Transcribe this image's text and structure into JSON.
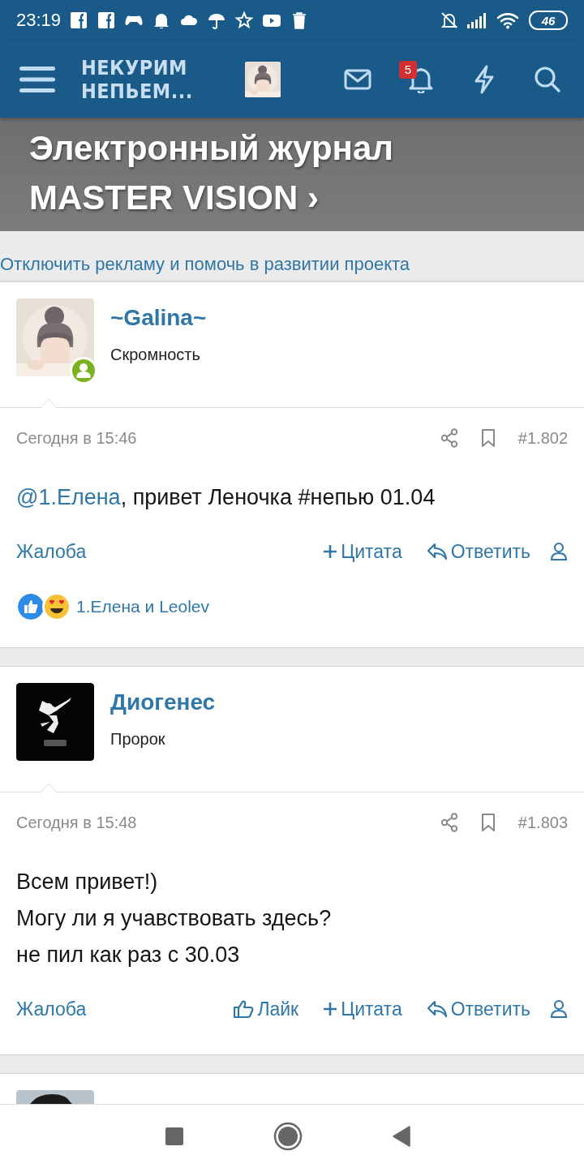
{
  "status_bar": {
    "time": "23:19",
    "battery": "46"
  },
  "header": {
    "logo": [
      "НЕКУРИМ",
      "НЕПЬЕМ..."
    ],
    "notification_count": "5"
  },
  "banner": {
    "lines": [
      "Электронный журнал",
      "MASTER VISION ›"
    ]
  },
  "ad_link": "Отключить рекламу и помочь в развитии проекта",
  "posts": [
    {
      "author": "~Galina~",
      "user_title": "Скромность",
      "online": true,
      "date": "Сегодня в 15:46",
      "number": "#1.802",
      "message": [
        {
          "kind": "mention",
          "text": "@1.Елена"
        },
        {
          "kind": "text",
          "text": ", привет Леночка #непью 01.04"
        }
      ],
      "report": "Жалоба",
      "actions": [
        {
          "kind": "quote",
          "label": "Цитата"
        },
        {
          "kind": "reply",
          "label": "Ответить"
        }
      ],
      "reactions": {
        "text": "1.Елена и Leolev"
      }
    },
    {
      "author": "Диогенес",
      "user_title": "Пророк",
      "online": false,
      "date": "Сегодня в 15:48",
      "number": "#1.803",
      "message": [
        {
          "kind": "text",
          "text": "Всем привет!)"
        },
        {
          "kind": "break"
        },
        {
          "kind": "text",
          "text": "Могу ли я учавствовать здесь?"
        },
        {
          "kind": "break"
        },
        {
          "kind": "text",
          "text": "не пил как раз с 30.03"
        }
      ],
      "report": "Жалоба",
      "actions": [
        {
          "kind": "like",
          "label": "Лайк"
        },
        {
          "kind": "quote",
          "label": "Цитата"
        },
        {
          "kind": "reply",
          "label": "Ответить"
        }
      ]
    }
  ]
}
